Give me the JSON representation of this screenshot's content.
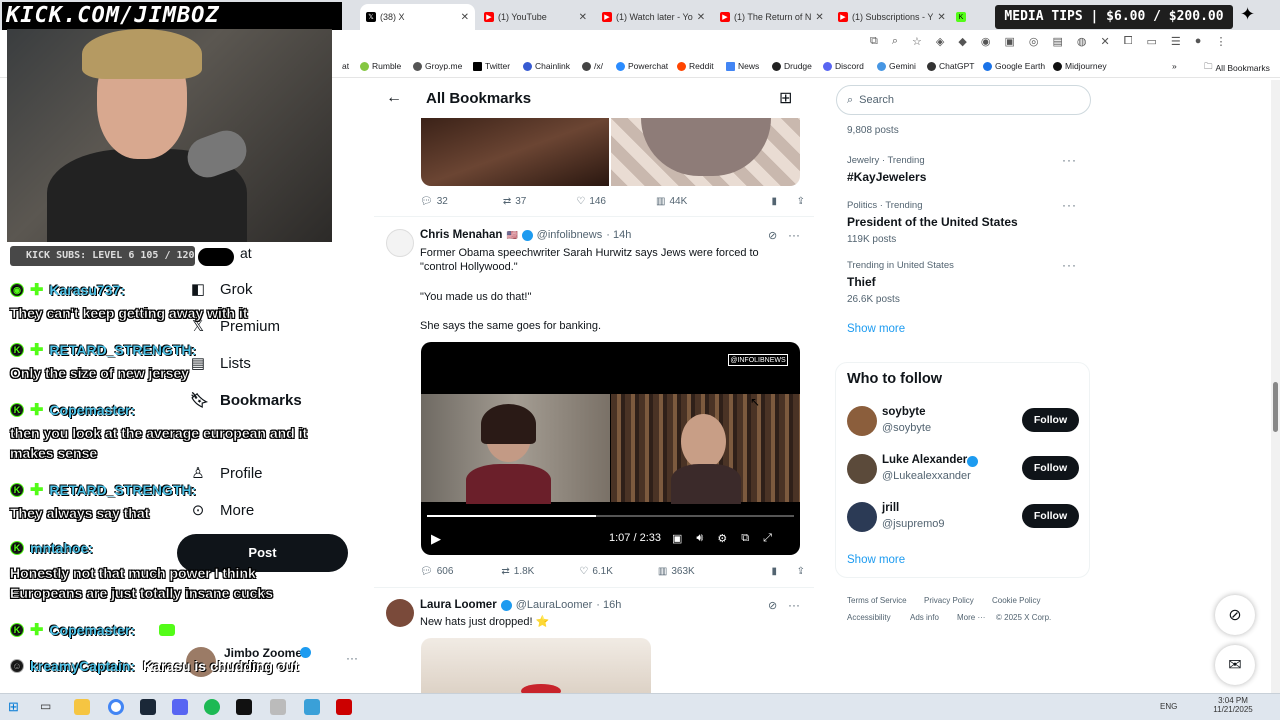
{
  "overlay": {
    "kick_url": "KICK.COM/JIMBOZ",
    "subs_text": "KICK SUBS: LEVEL 6 105 / 120",
    "media_tips": "MEDIA TIPS | $6.00 / $200.00"
  },
  "browser": {
    "tabs": [
      {
        "label": "(38) X",
        "color": "#000000"
      },
      {
        "label": "(1) YouTube",
        "color": "#ff0000"
      },
      {
        "label": "(1) Watch later - Yo",
        "color": "#ff0000"
      },
      {
        "label": "(1) The Return of N",
        "color": "#ff0000"
      },
      {
        "label": "(1) Subscriptions - Y",
        "color": "#ff0000"
      }
    ],
    "bookmarks": [
      "at",
      "Rumble",
      "Groyp.me",
      "Twitter",
      "Chainlink",
      "/x/",
      "Powerchat",
      "Reddit",
      "News",
      "Drudge",
      "Discord",
      "Gemini",
      "ChatGPT",
      "Google Earth",
      "Midjourney"
    ],
    "all_bookmarks": "All Bookmarks"
  },
  "chat": [
    {
      "name": "Karasu737:",
      "msg": "They can't keep getting away with it"
    },
    {
      "name": "RETARD_STRENGTH:",
      "msg": "Only the size of new jersey"
    },
    {
      "name": "Copemaster:",
      "msg": "then you look at the average european and it",
      "msg2": "makes sense"
    },
    {
      "name": "RETARD_STRENGTH:",
      "msg": "They always say that"
    },
    {
      "name": "mntahoe:",
      "msg": "Honestly not that much power I think",
      "msg2": "Europeans are just totally insane cucks"
    },
    {
      "name": "Copemaster:",
      "msg": ""
    },
    {
      "name": "kreamyCaptain:",
      "msg": "Karasu is chudding out"
    }
  ],
  "nav": {
    "partial": "at",
    "items": [
      "Grok",
      "Premium",
      "Lists",
      "Bookmarks",
      "Profile",
      "More"
    ],
    "post": "Post",
    "account_name": "Jimbo Zoomer"
  },
  "main": {
    "header": "All Bookmarks",
    "tweet1_stats": {
      "replies": "32",
      "reposts": "37",
      "likes": "146",
      "views": "44K"
    },
    "tweet2": {
      "name": "Chris Menahan",
      "handle": "@infolibnews",
      "time": "· 14h",
      "line1": "Former Obama speechwriter Sarah Hurwitz says Jews were forced to",
      "line2": "\"control Hollywood.\"",
      "line3": "\"You made us do that!\"",
      "line4": "She says the same goes for banking.",
      "watermark": "@INFOLIBNEWS",
      "time_display": "1:07 / 2:33",
      "progress": 0.46,
      "stats": {
        "replies": "606",
        "reposts": "1.8K",
        "likes": "6.1K",
        "views": "363K"
      }
    },
    "tweet3": {
      "name": "Laura Loomer",
      "handle": "@LauraLoomer",
      "time": "· 16h",
      "text": "New hats just dropped! ⭐"
    }
  },
  "sidebar": {
    "search_placeholder": "Search",
    "posts_top": "9,808 posts",
    "trends": [
      {
        "meta": "Jewelry · Trending",
        "title": "#KayJewelers",
        "count": ""
      },
      {
        "meta": "Politics · Trending",
        "title": "President of the United States",
        "count": "119K posts"
      },
      {
        "meta": "Trending in United States",
        "title": "Thief",
        "count": "26.6K posts"
      }
    ],
    "show_more": "Show more",
    "who_to_follow": "Who to follow",
    "follows": [
      {
        "name": "soybyte",
        "handle": "@soybyte",
        "button": "Follow"
      },
      {
        "name": "Luke Alexander",
        "handle": "@Lukealexxander",
        "button": "Follow"
      },
      {
        "name": "jrill",
        "handle": "@jsupremo9",
        "button": "Follow"
      }
    ],
    "show_more2": "Show more",
    "footer": [
      "Terms of Service",
      "Privacy Policy",
      "Cookie Policy",
      "Accessibility",
      "Ads info",
      "More ···",
      "© 2025 X Corp."
    ]
  },
  "taskbar": {
    "lang": "ENG",
    "time": "3:04 PM",
    "date": "11/21/2025"
  }
}
